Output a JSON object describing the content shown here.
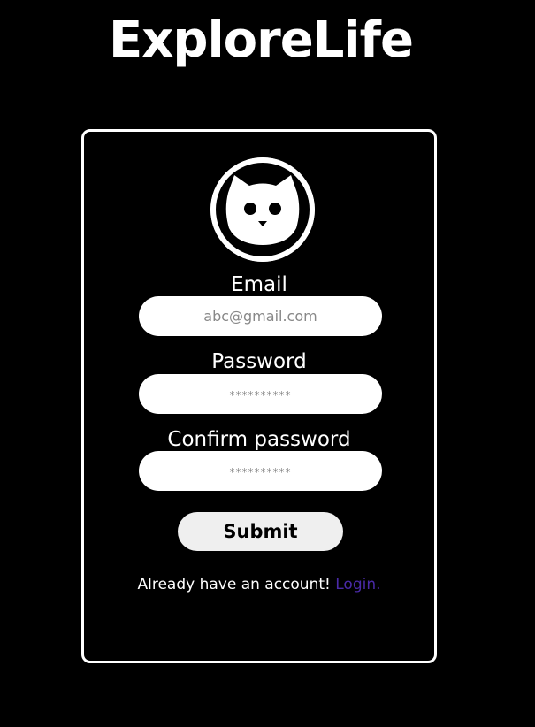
{
  "header": {
    "brand": "ExploreLife"
  },
  "avatar": {
    "icon": "cat-icon"
  },
  "form": {
    "email": {
      "label": "Email",
      "placeholder": "abc@gmail.com",
      "value": ""
    },
    "password": {
      "label": "Password",
      "placeholder": "**********",
      "value": ""
    },
    "confirm_password": {
      "label": "Confirm password",
      "placeholder": "**********",
      "value": ""
    },
    "submit_label": "Submit"
  },
  "footer": {
    "prompt": "Already have an account!",
    "login_link": "Login."
  },
  "colors": {
    "background": "#000000",
    "text": "#ffffff",
    "link": "#4a2aa8",
    "button": "#efefef"
  }
}
